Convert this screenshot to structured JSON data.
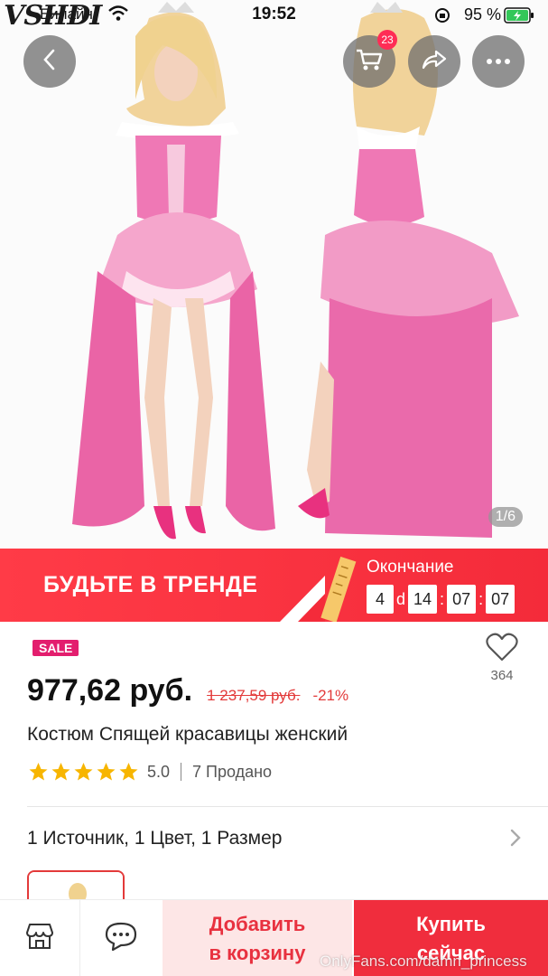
{
  "status_bar": {
    "carrier": "Билайн",
    "time": "19:52",
    "battery": "95 %"
  },
  "watermark_logo": "VSHDI",
  "header": {
    "cart_badge": "23",
    "image_counter": "1/6"
  },
  "promo": {
    "title": "БУДЬТЕ В ТРЕНДЕ",
    "end_label": "Окончание",
    "countdown": {
      "days": "4",
      "days_unit": "d",
      "hours": "14",
      "minutes": "07",
      "seconds": "07"
    }
  },
  "product": {
    "sale_badge": "SALE",
    "wishlist_count": "364",
    "price": "977,62 руб.",
    "old_price": "1 237,59 руб.",
    "discount": "-21%",
    "title": "Костюм Спящей красавицы женский",
    "rating": "5.0",
    "rating_stars": 5,
    "sold": "7 Продано",
    "variants": "1 Источник, 1 Цвет, 1 Размер"
  },
  "bottom_bar": {
    "add_to_cart_line1": "Добавить",
    "add_to_cart_line2": "в корзину",
    "buy_now_line1": "Купить",
    "buy_now_line2": "сейчас"
  },
  "watermark_text": "OnlyFans.com/damn_princess",
  "colors": {
    "accent_red": "#f02d3d",
    "promo_red": "#ff3b47",
    "sale_pink": "#e31e6e",
    "star_yellow": "#f7b500",
    "dress_pink": "#ee6fae"
  }
}
